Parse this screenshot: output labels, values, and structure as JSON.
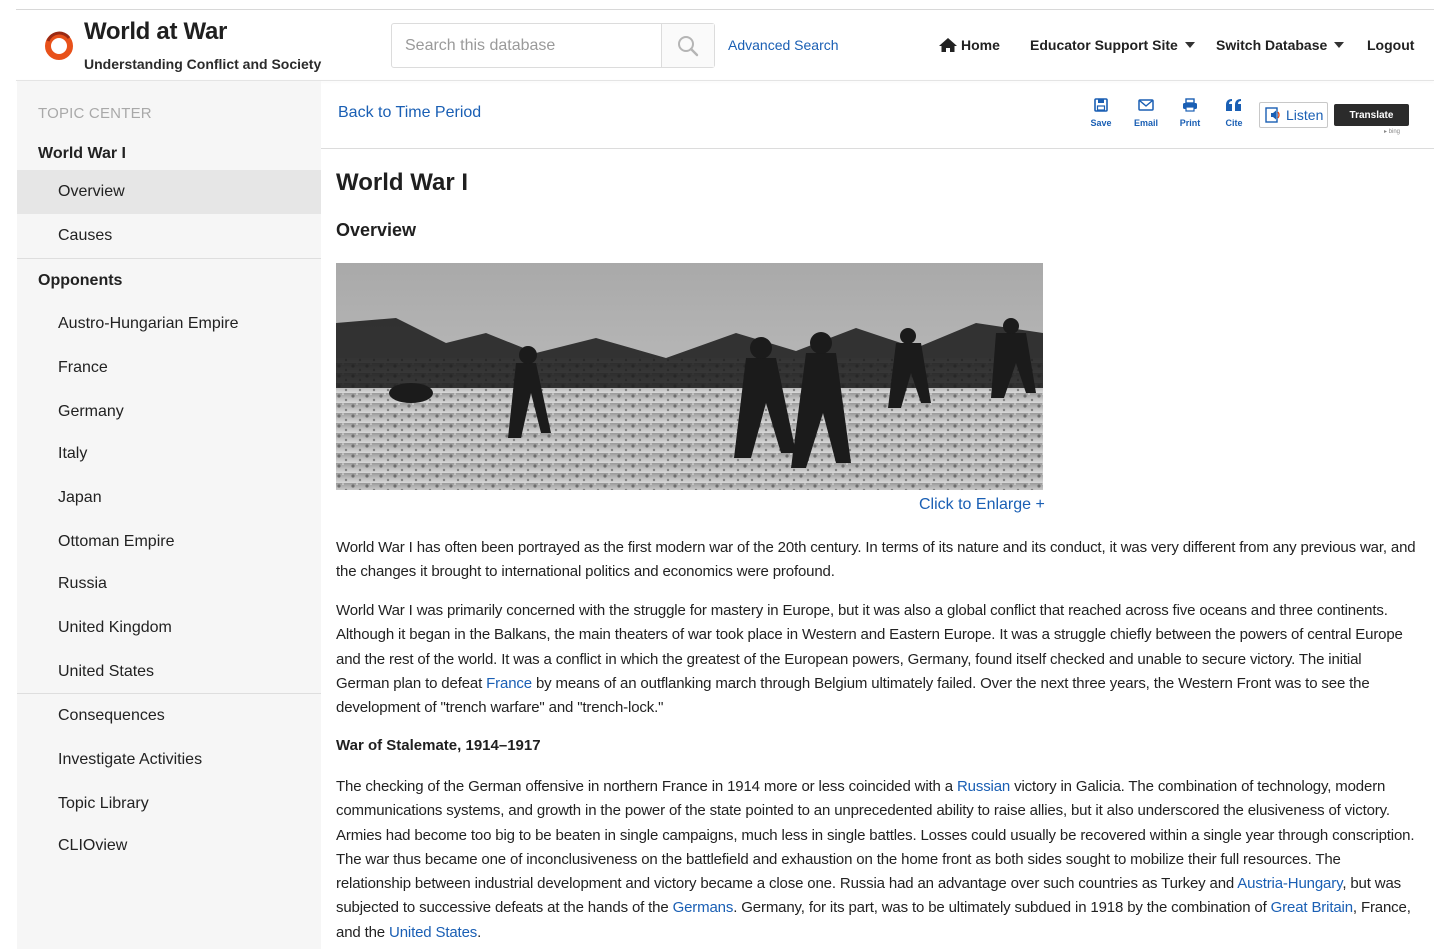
{
  "header": {
    "title": "World at War",
    "subtitle": "Understanding Conflict and Society",
    "search_placeholder": "Search this database",
    "advanced_search": "Advanced Search",
    "nav": {
      "home": "Home",
      "educator": "Educator Support Site",
      "switch_db": "Switch Database",
      "logout": "Logout"
    }
  },
  "sidebar": {
    "heading": "TOPIC CENTER",
    "items": [
      {
        "label": "World War I",
        "level": 1,
        "active": false
      },
      {
        "label": "Overview",
        "level": 2,
        "active": true
      },
      {
        "label": "Causes",
        "level": 2,
        "active": false
      },
      {
        "label": "Opponents",
        "level": 1,
        "active": false
      },
      {
        "label": "Austro-Hungarian Empire",
        "level": 2,
        "active": false
      },
      {
        "label": "France",
        "level": 2,
        "active": false
      },
      {
        "label": "Germany",
        "level": 2,
        "active": false
      },
      {
        "label": "Italy",
        "level": 2,
        "active": false
      },
      {
        "label": "Japan",
        "level": 2,
        "active": false
      },
      {
        "label": "Ottoman Empire",
        "level": 2,
        "active": false
      },
      {
        "label": "Russia",
        "level": 2,
        "active": false
      },
      {
        "label": "United Kingdom",
        "level": 2,
        "active": false
      },
      {
        "label": "United States",
        "level": 2,
        "active": false
      },
      {
        "label": "Consequences",
        "level": 2,
        "active": false
      },
      {
        "label": "Investigate Activities",
        "level": 2,
        "active": false
      },
      {
        "label": "Topic Library",
        "level": 2,
        "active": false
      },
      {
        "label": "CLIOview",
        "level": 2,
        "active": false
      }
    ]
  },
  "toolbar": {
    "back": "Back to Time Period",
    "save": "Save",
    "email": "Email",
    "print": "Print",
    "cite": "Cite",
    "listen": "Listen",
    "translate": "Translate"
  },
  "main": {
    "title": "World War I",
    "section": "Overview",
    "enlarge": "Click to Enlarge +",
    "subheading": "War of Stalemate, 1914–1917",
    "p1": "World War I has often been portrayed as the first modern war of the 20th century. In terms of its nature and its conduct, it was very different from any previous war, and the changes it brought to international politics and economics were profound.",
    "p2": {
      "before": "World War I was primarily concerned with the struggle for mastery in Europe, but it was also a global conflict that reached across five oceans and three continents. Although it began in the Balkans, the main theaters of war took place in Western and Eastern Europe. It was a struggle chiefly between the powers of central Europe and the rest of the world. It was a conflict in which the greatest of the European powers, Germany, found itself checked and unable to secure victory. The initial German plan to defeat ",
      "link1": "France",
      "after": " by means of an outflanking march through Belgium ultimately failed. Over the next three years, the Western Front was to see the development of \"trench warfare\" and \"trench-lock.\""
    },
    "p3": {
      "t1": "The checking of the German offensive in northern France in 1914 more or less coincided with a ",
      "l1": "Russian",
      "t2": " victory in Galicia. The combination of technology, modern communications systems, and growth in the power of the state pointed to an unprecedented ability to raise allies, but it also underscored the elusiveness of victory. Armies had become too big to be beaten in single campaigns, much less in single battles. Losses could usually be recovered within a single year through conscription. The war thus became one of inconclusiveness on the battlefield and exhaustion on the home front as both sides sought to mobilize their full resources. The relationship between industrial development and victory became a close one. Russia had an advantage over such countries as Turkey and ",
      "l2": "Austria-Hungary",
      "t3": ", but was subjected to successive defeats at the hands of the ",
      "l3": "Germans",
      "t4": ". Germany, for its part, was to be ultimately subdued in 1918 by the combination of ",
      "l4": "Great Britain",
      "t5": ", France, and the ",
      "l5": "United States",
      "t6": "."
    }
  }
}
